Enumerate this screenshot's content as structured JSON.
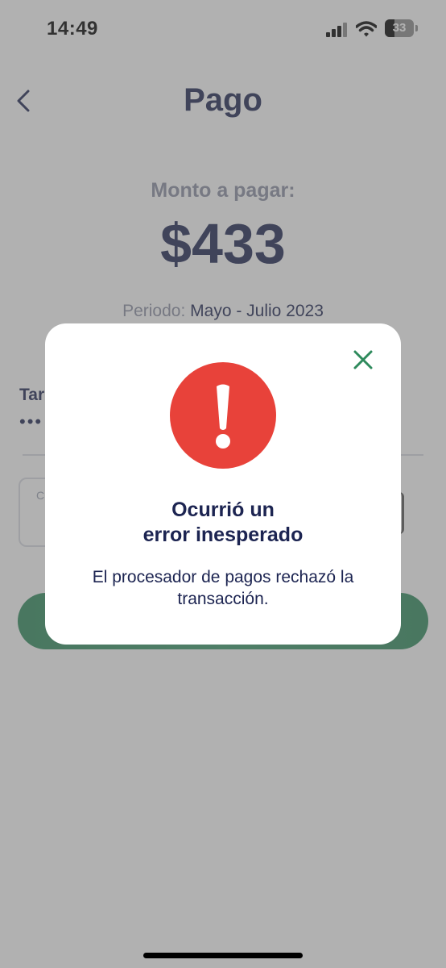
{
  "status_bar": {
    "time": "14:49",
    "battery": "33",
    "icons": [
      "signal-icon",
      "wifi-icon",
      "battery-icon"
    ]
  },
  "header": {
    "title": "Pago",
    "back_icon": "chevron-left-icon"
  },
  "payment": {
    "amount_label": "Monto a pagar:",
    "amount": "$433",
    "period_label": "Periodo:",
    "period_value": "Mayo - Julio 2023",
    "card_label_partial": "Tar",
    "card_dots": "•••",
    "cvv_placeholder_partial": "C"
  },
  "modal": {
    "close_icon": "close-icon",
    "error_icon": "exclamation-icon",
    "title_line1": "Ocurrió un",
    "title_line2": "error inesperado",
    "message_line1": "El procesador de pagos rechazó la",
    "message_line2": "transacción."
  },
  "colors": {
    "primary_text": "#1c2451",
    "muted_text": "#8a8fa3",
    "accent_green": "#2e8a5c",
    "error_red": "#e8423a",
    "overlay": "rgba(100,100,100,0.5)"
  }
}
